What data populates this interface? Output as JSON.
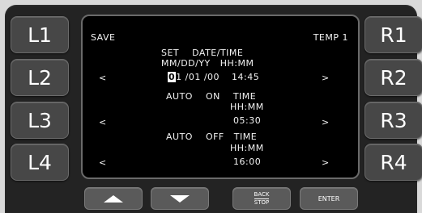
{
  "left_buttons": [
    "L1",
    "L2",
    "L3",
    "L4"
  ],
  "right_buttons": [
    "R1",
    "R2",
    "R3",
    "R4"
  ],
  "screen": {
    "left_label": "SAVE",
    "right_label": "TEMP 1",
    "set_title": "SET    DATE/TIME",
    "date_header": "MM/DD/YY   HH:MM",
    "date_cursor": "0",
    "date_rest": "1 /01 /00",
    "date_time": "14:45",
    "auto_on_title": "AUTO    ON    TIME",
    "auto_on_sub": "HH:MM",
    "auto_on_value": "05:30",
    "auto_off_title": "AUTO    OFF   TIME",
    "auto_off_sub": "HH:MM",
    "auto_off_value": "16:00",
    "arrow_left": "<",
    "arrow_right": ">"
  },
  "bottom_buttons": {
    "back_top": "BACK",
    "back_bottom": "STOP",
    "enter": "ENTER"
  }
}
